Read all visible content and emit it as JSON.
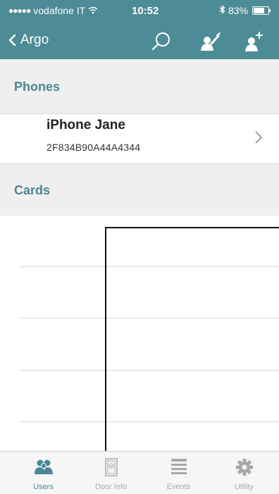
{
  "status_bar": {
    "carrier": "vodafone IT",
    "time": "10:52",
    "battery_percent": "83%",
    "battery_level": 0.83
  },
  "nav": {
    "back_label": "Argo",
    "icons": [
      "search-icon",
      "edit-user-icon",
      "add-user-icon"
    ]
  },
  "sections": {
    "phones_title": "Phones",
    "cards_title": "Cards"
  },
  "phones": [
    {
      "name": "iPhone Jane",
      "id": "2F834B90A44A4344"
    }
  ],
  "tabbar": {
    "tabs": [
      {
        "label": "Users",
        "icon": "users-icon",
        "active": true
      },
      {
        "label": "Door Info",
        "icon": "door-info-icon",
        "active": false
      },
      {
        "label": "Events",
        "icon": "events-list-icon",
        "active": false
      },
      {
        "label": "Utility",
        "icon": "gear-icon",
        "active": false
      }
    ]
  },
  "colors": {
    "accent": "#4d8b96",
    "section_text": "#4a8794",
    "section_bg": "#efefef",
    "tab_inactive": "#a8a8a8"
  }
}
